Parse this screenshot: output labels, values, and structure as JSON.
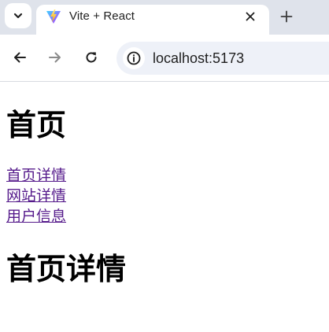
{
  "browser": {
    "tab": {
      "title": "Vite + React",
      "favicon": "vite-logo-icon"
    },
    "address_bar": {
      "url": "localhost:5173"
    },
    "icons": {
      "tab_menu": "chevron-down-icon",
      "close": "close-icon",
      "new_tab": "plus-icon",
      "back": "back-arrow-icon",
      "forward": "forward-arrow-icon",
      "reload": "reload-icon",
      "site_info": "info-icon"
    }
  },
  "page": {
    "heading": "首页",
    "links": [
      {
        "label": "首页详情"
      },
      {
        "label": "网站详情"
      },
      {
        "label": "用户信息"
      }
    ],
    "subheading": "首页详情"
  },
  "colors": {
    "tabstrip_bg": "#dfe3eb",
    "omnibox_bg": "#eef1f8",
    "visited_link": "#551a8b"
  }
}
